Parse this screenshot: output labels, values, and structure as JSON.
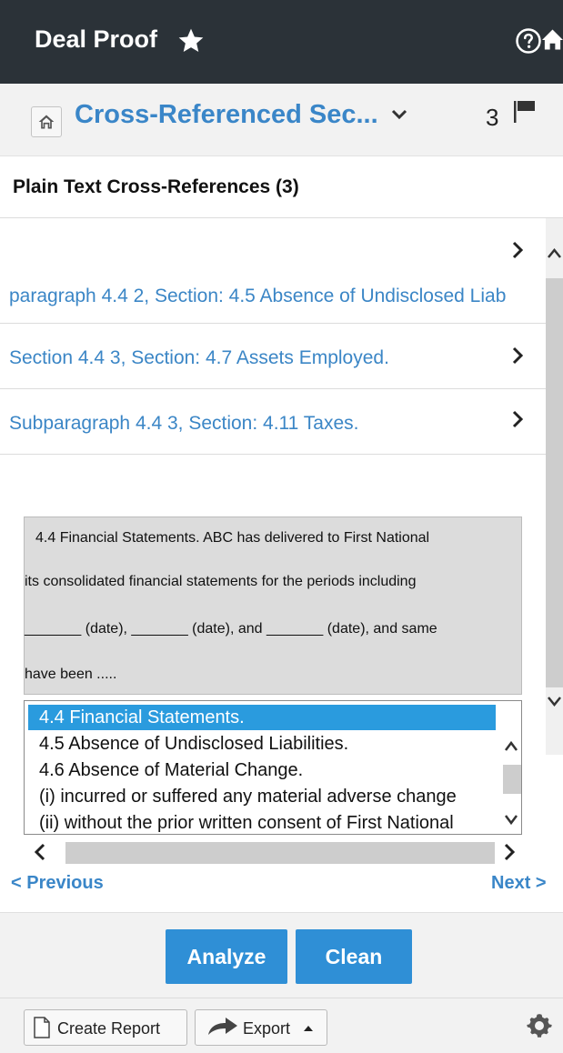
{
  "header": {
    "app_title": "Deal Proof",
    "icons": [
      "star-icon",
      "help-icon",
      "home-icon"
    ]
  },
  "section": {
    "title": "Cross-Referenced Sec...",
    "flag_count": "3"
  },
  "cross_references": {
    "heading": "Plain Text Cross-References (3)",
    "items": [
      {
        "label": ""
      },
      {
        "label": "paragraph 4.4 2, Section: 4.5 Absence of Undisclosed Liab"
      },
      {
        "label": "Section 4.4 3, Section: 4.7 Assets Employed."
      },
      {
        "label": "Subparagraph 4.4 3, Section: 4.11 Taxes."
      }
    ]
  },
  "preview": {
    "lines": [
      "4.4 Financial Statements. ABC has delivered to First National",
      "its consolidated financial statements for the periods including",
      "_______ (date), _______ (date), and _______ (date), and same",
      "have been ....."
    ]
  },
  "outline": {
    "items": [
      {
        "label": "4.4 Financial Statements.",
        "selected": true
      },
      {
        "label": "4.5 Absence of Undisclosed Liabilities.",
        "selected": false
      },
      {
        "label": "4.6 Absence of Material Change.",
        "selected": false
      },
      {
        "label": "  (i) incurred or suffered any material adverse change",
        "selected": false
      },
      {
        "label": "  (ii) without the prior written consent of First National",
        "selected": false
      }
    ]
  },
  "navigation": {
    "previous": "< Previous",
    "next": "Next >"
  },
  "actions": {
    "analyze": "Analyze",
    "clean": "Clean",
    "create_report": "Create Report",
    "export": "Export"
  },
  "colors": {
    "topbar": "#2b3238",
    "link": "#3a86c8",
    "button": "#2f8fd6",
    "selection": "#2a9bde"
  }
}
